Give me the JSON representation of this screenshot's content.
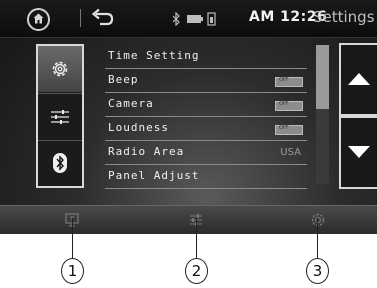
{
  "status_bar": {
    "time": "AM 12:26",
    "title": "Settings"
  },
  "side_tabs": [
    {
      "name": "settings",
      "icon": "gear-icon",
      "selected": true
    },
    {
      "name": "sound",
      "icon": "equalizer-icon",
      "selected": false
    },
    {
      "name": "bluetooth",
      "icon": "bluetooth-icon",
      "selected": false
    }
  ],
  "menu": [
    {
      "label": "Time Setting"
    },
    {
      "label": "Beep",
      "toggle": "OFF"
    },
    {
      "label": "Camera",
      "toggle": "OFF"
    },
    {
      "label": "Loudness",
      "toggle": "OFF"
    },
    {
      "label": "Radio Area",
      "value": "USA"
    },
    {
      "label": "Panel Adjust"
    }
  ],
  "scroll": {
    "position_fraction": 0.0
  },
  "callouts": [
    "1",
    "2",
    "3"
  ],
  "colors": {
    "background": "#1e1e1e",
    "text": "#f0f0f0",
    "accent_white": "#ffffff"
  }
}
